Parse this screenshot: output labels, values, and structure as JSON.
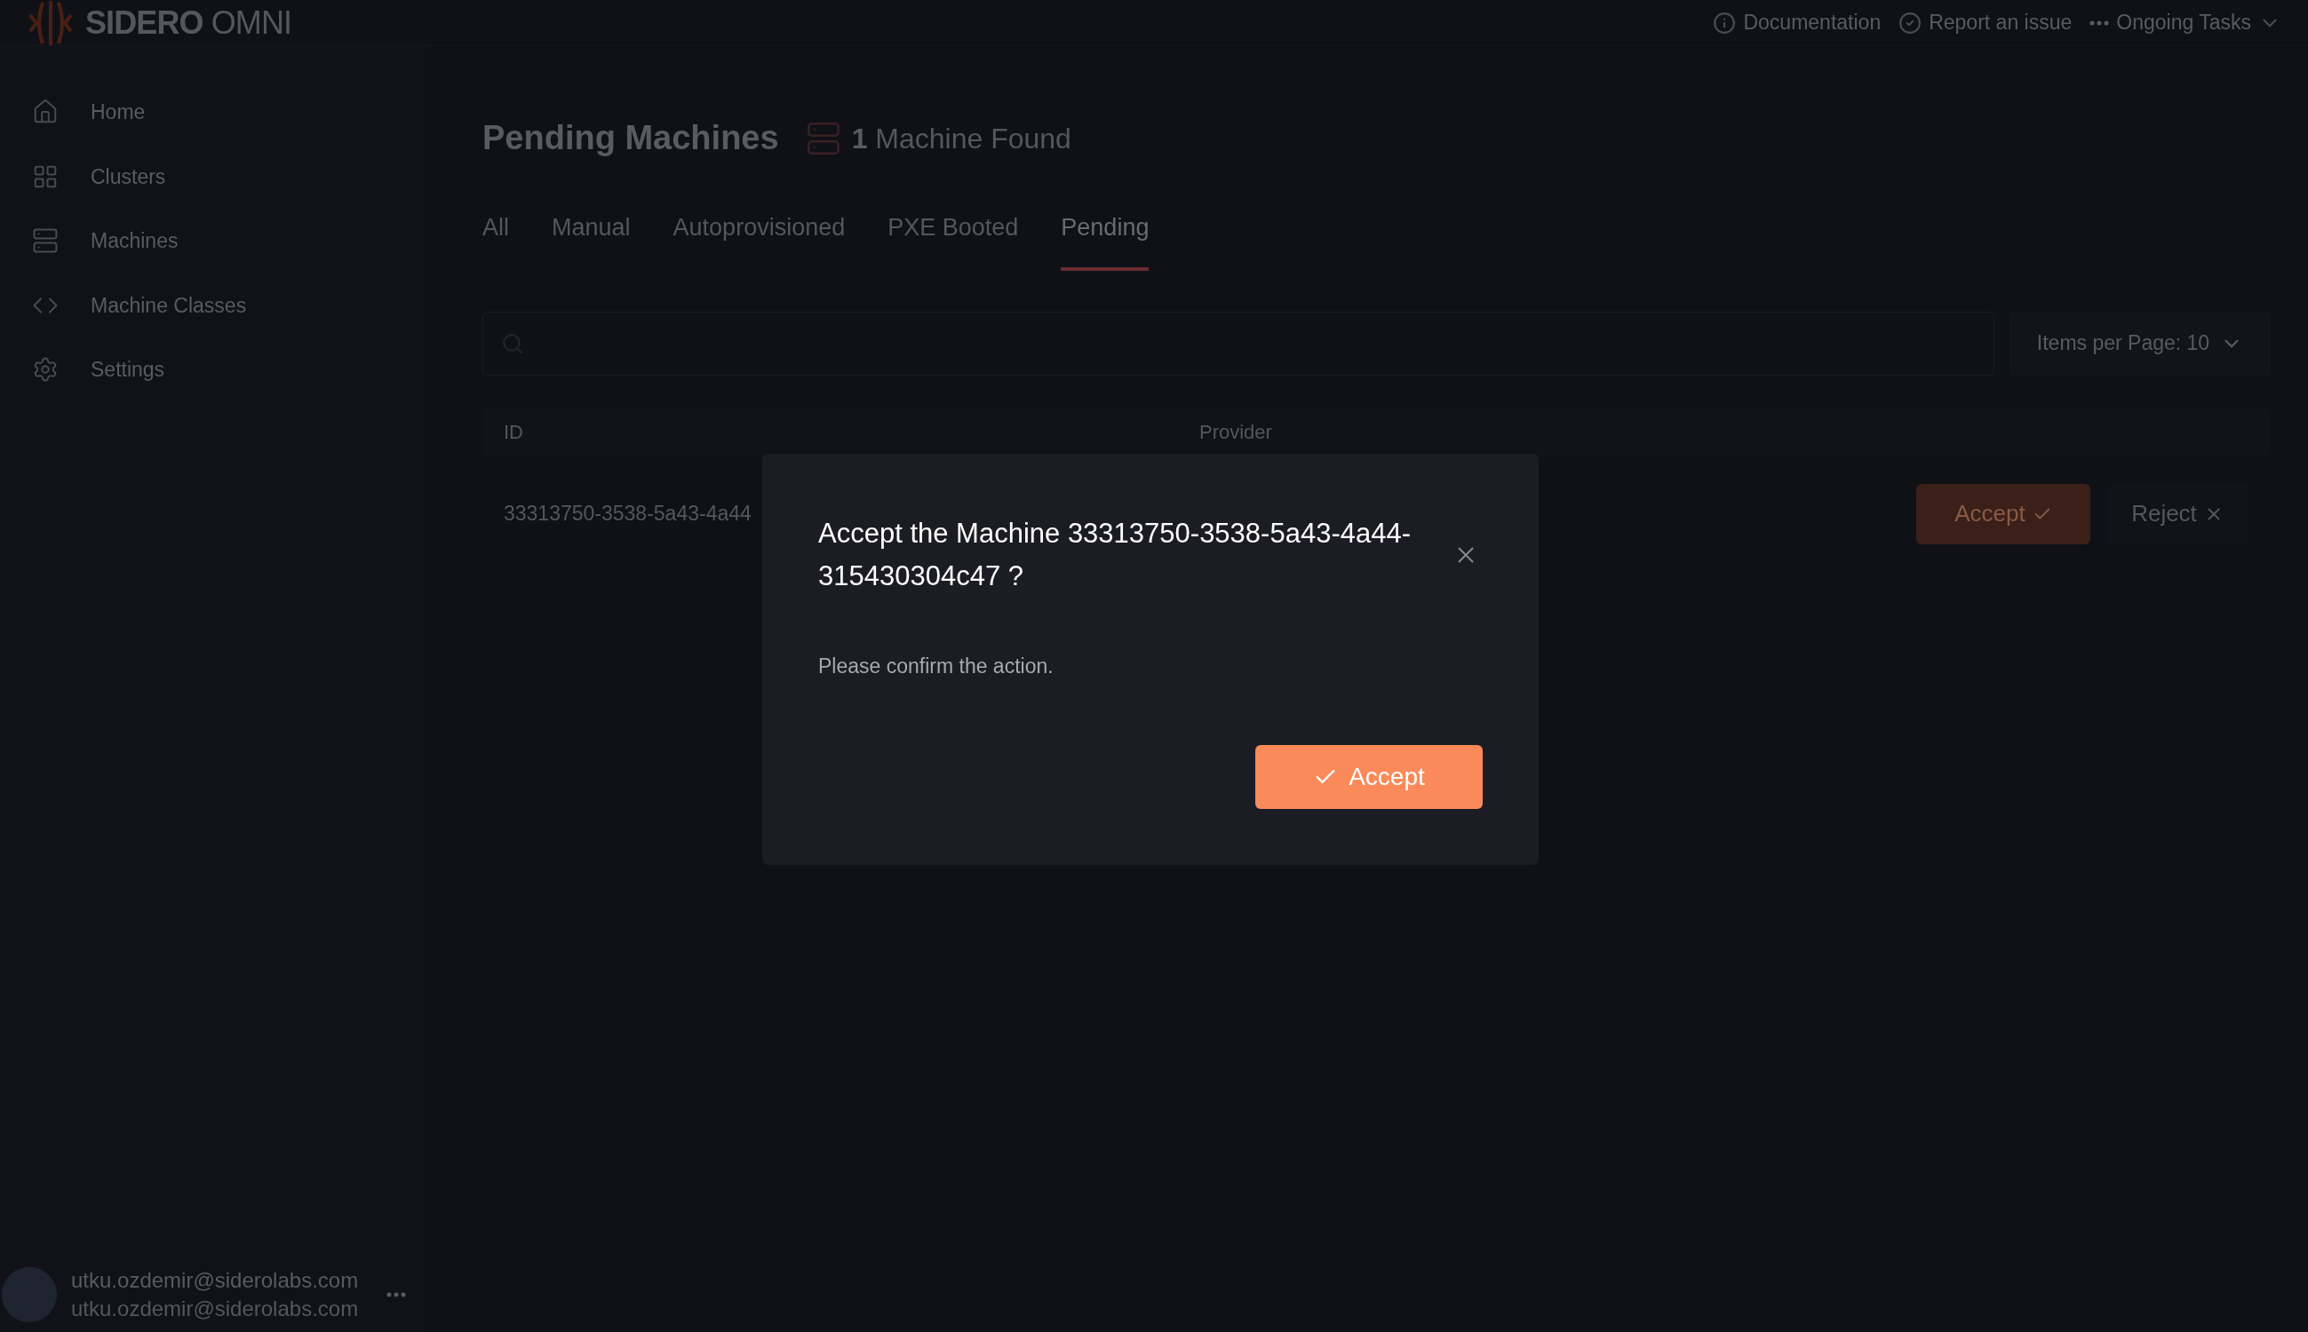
{
  "header": {
    "logo": {
      "brand": "SIDERO",
      "product": "OMNI"
    },
    "links": [
      {
        "label": "Documentation",
        "kind": "info"
      },
      {
        "label": "Report an issue",
        "kind": "check"
      },
      {
        "label": "Ongoing Tasks",
        "kind": "tasks"
      }
    ]
  },
  "sidebar": {
    "items": [
      {
        "label": "Home"
      },
      {
        "label": "Clusters"
      },
      {
        "label": "Machines"
      },
      {
        "label": "Machine Classes"
      },
      {
        "label": "Settings"
      }
    ],
    "user": {
      "name": "utku.ozdemir@siderolabs.com",
      "email": "utku.ozdemir@siderolabs.com"
    }
  },
  "page": {
    "title": "Pending Machines",
    "count": "1",
    "count_label": "Machine Found",
    "tabs": [
      {
        "label": "All",
        "selected": false
      },
      {
        "label": "Manual",
        "selected": false
      },
      {
        "label": "Autoprovisioned",
        "selected": false
      },
      {
        "label": "PXE Booted",
        "selected": false
      },
      {
        "label": "Pending",
        "selected": true
      }
    ],
    "items_per_page": "Items per Page: 10",
    "table": {
      "columns": [
        "ID",
        "Provider"
      ],
      "rows": [
        {
          "id": "33313750-3538-5a43-4a44",
          "actions": [
            {
              "label": "Accept",
              "kind": "primary"
            },
            {
              "label": "Reject",
              "kind": "secondary"
            }
          ]
        }
      ]
    }
  },
  "dialog": {
    "title": "Accept the Machine 33313750-3538-5a43-4a44-315430304c47 ?",
    "message": "Please confirm the action.",
    "confirm": "Accept"
  }
}
